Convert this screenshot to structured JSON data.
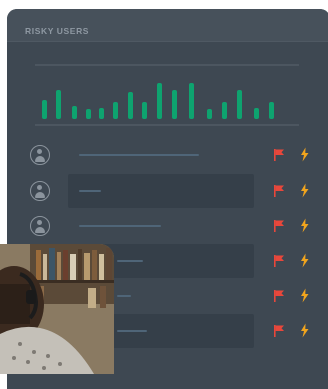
{
  "panel": {
    "title": "RISKY USERS"
  },
  "activity_chart": {
    "bar_levels": [
      0.5,
      0.75,
      0.35,
      0.25,
      0.3,
      0.45,
      0.7,
      0.45,
      0.95,
      0.75,
      0.95,
      0.25,
      0.45,
      0.75,
      0.3,
      0.45
    ],
    "bar_color": "#0ea36f"
  },
  "users": [
    {
      "name": "",
      "flag_icon": "red-flag-icon",
      "risk_icon": "lightning-icon"
    },
    {
      "name": "",
      "flag_icon": "red-flag-icon",
      "risk_icon": "lightning-icon"
    },
    {
      "name": "",
      "flag_icon": "red-flag-icon",
      "risk_icon": "lightning-icon"
    },
    {
      "name": "",
      "flag_icon": "red-flag-icon",
      "risk_icon": "lightning-icon"
    },
    {
      "name": "",
      "flag_icon": "red-flag-icon",
      "risk_icon": "lightning-icon"
    },
    {
      "name": "",
      "flag_icon": "red-flag-icon",
      "risk_icon": "lightning-icon"
    }
  ],
  "colors": {
    "panel_background": "#3e4852",
    "flag": "#e8473b",
    "lightning": "#f2a51d"
  },
  "photo": {
    "description_icon": "person-photo"
  }
}
